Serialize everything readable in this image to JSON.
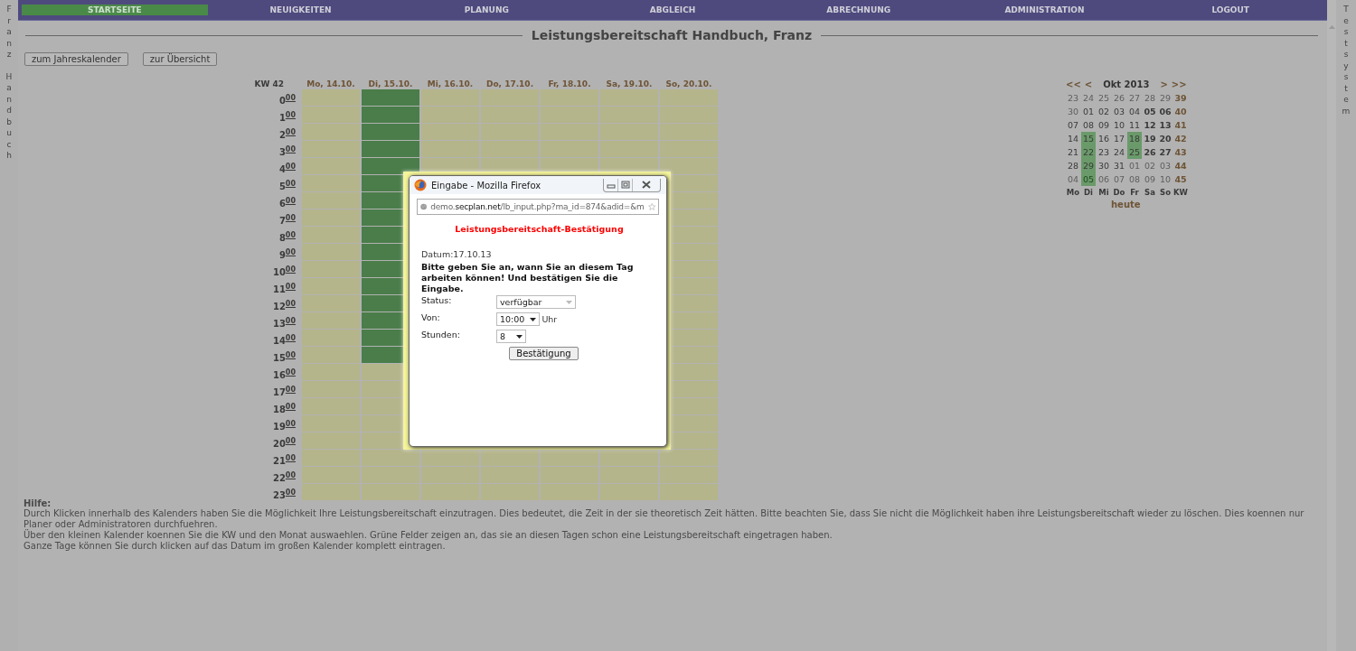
{
  "side_left": "FranzHandbuch",
  "side_right": "Testsystem",
  "nav": [
    {
      "label": "STARTSEITE",
      "selected": true
    },
    {
      "label": "NEUIGKEITEN",
      "selected": false
    },
    {
      "label": "PLANUNG",
      "selected": false
    },
    {
      "label": "ABGLEICH",
      "selected": false
    },
    {
      "label": "ABRECHNUNG",
      "selected": false
    },
    {
      "label": "ADMINISTRATION",
      "selected": false
    },
    {
      "label": "LOGOUT",
      "selected": false
    }
  ],
  "title": "Leistungsbereitschaft Handbuch, Franz",
  "buttons": [
    "zum Jahreskalender",
    "zur Übersicht"
  ],
  "week": {
    "label": "KW 42",
    "days": [
      {
        "label": "Mo, 14.10.",
        "cells_above": [
          false,
          false,
          false,
          false,
          false,
          false,
          false,
          false,
          false,
          false,
          false,
          false,
          false,
          false,
          false,
          false,
          false,
          false,
          false,
          false,
          false,
          false,
          false,
          false
        ]
      },
      {
        "label": "Di, 15.10.",
        "cells_above": [
          true,
          true,
          true,
          true,
          true,
          true,
          true,
          true,
          true,
          true,
          true,
          true,
          true,
          true,
          true,
          true,
          false,
          false,
          false,
          false,
          false,
          false,
          false,
          false
        ]
      },
      {
        "label": "Mi, 16.10.",
        "cells_above": [
          false,
          false,
          false,
          false,
          false
        ],
        "cells_below": [
          false,
          false,
          false
        ]
      },
      {
        "label": "Do, 17.10.",
        "cells_above": [
          false,
          false,
          false,
          false,
          false
        ],
        "cells_below": [
          false,
          false,
          false
        ]
      },
      {
        "label": "Fr, 18.10.",
        "cells_above": [
          false,
          false,
          false,
          false,
          false
        ],
        "cells_below": [
          false,
          false,
          false
        ]
      },
      {
        "label": "Sa, 19.10.",
        "cells_above": [
          false,
          false,
          false,
          false,
          false
        ],
        "cells_below": [
          false,
          false,
          false
        ]
      },
      {
        "label": "So, 20.10.",
        "cells_above": [
          false,
          false,
          false,
          false,
          false,
          false,
          false,
          false,
          false,
          false,
          false,
          false,
          false,
          false,
          false,
          false,
          false,
          false,
          false,
          false,
          false,
          false,
          false,
          false
        ]
      }
    ],
    "hours": [
      "0$^{00}$",
      "1$^{00}$",
      "2$^{00}$",
      "3$^{00}$",
      "4$^{00}$",
      "5$^{00}$",
      "6$^{00}$",
      "7$^{00}$",
      "8$^{00}$",
      "9$^{00}$",
      "10$^{00}$",
      "11$^{00}$",
      "12$^{00}$",
      "13$^{00}$",
      "14$^{00}$",
      "15$^{00}$",
      "16$^{00}$",
      "17$^{00}$",
      "18$^{00}$",
      "19$^{00}$",
      "20$^{00}$",
      "21$^{00}$",
      "22$^{00}$",
      "23$^{00}$"
    ]
  },
  "mini_calendar": {
    "nav": [
      "<<",
      "<",
      ">",
      ">>"
    ],
    "month": "Okt 2013",
    "weeks": [
      {
        "kw": "39",
        "days": [
          {
            "d": "23",
            "kind": "other",
            "marked": false
          },
          {
            "d": "24",
            "kind": "other",
            "marked": false
          },
          {
            "d": "25",
            "kind": "other",
            "marked": false
          },
          {
            "d": "26",
            "kind": "other",
            "marked": false
          },
          {
            "d": "27",
            "kind": "other",
            "marked": false
          },
          {
            "d": "28",
            "kind": "other",
            "marked": false
          },
          {
            "d": "29",
            "kind": "other",
            "marked": false
          }
        ]
      },
      {
        "kw": "40",
        "days": [
          {
            "d": "30",
            "kind": "other",
            "marked": false
          },
          {
            "d": "01",
            "kind": "day",
            "marked": false
          },
          {
            "d": "02",
            "kind": "day",
            "marked": false
          },
          {
            "d": "03",
            "kind": "day",
            "marked": false
          },
          {
            "d": "04",
            "kind": "day",
            "marked": false
          },
          {
            "d": "05",
            "kind": "weekend",
            "marked": false
          },
          {
            "d": "06",
            "kind": "weekend",
            "marked": false
          }
        ]
      },
      {
        "kw": "41",
        "days": [
          {
            "d": "07",
            "kind": "day",
            "marked": false
          },
          {
            "d": "08",
            "kind": "day",
            "marked": false
          },
          {
            "d": "09",
            "kind": "day",
            "marked": false
          },
          {
            "d": "10",
            "kind": "day",
            "marked": false
          },
          {
            "d": "11",
            "kind": "day",
            "marked": false
          },
          {
            "d": "12",
            "kind": "weekend",
            "marked": false
          },
          {
            "d": "13",
            "kind": "weekend",
            "marked": false
          }
        ]
      },
      {
        "kw": "42",
        "days": [
          {
            "d": "14",
            "kind": "day",
            "marked": false
          },
          {
            "d": "15",
            "kind": "day",
            "marked": true
          },
          {
            "d": "16",
            "kind": "day",
            "marked": false
          },
          {
            "d": "17",
            "kind": "day",
            "marked": false
          },
          {
            "d": "18",
            "kind": "day",
            "marked": true
          },
          {
            "d": "19",
            "kind": "weekend",
            "marked": false
          },
          {
            "d": "20",
            "kind": "weekend",
            "marked": false
          }
        ]
      },
      {
        "kw": "43",
        "days": [
          {
            "d": "21",
            "kind": "day",
            "marked": false
          },
          {
            "d": "22",
            "kind": "day",
            "marked": true
          },
          {
            "d": "23",
            "kind": "day",
            "marked": false
          },
          {
            "d": "24",
            "kind": "day",
            "marked": false
          },
          {
            "d": "25",
            "kind": "day",
            "marked": true
          },
          {
            "d": "26",
            "kind": "weekend",
            "marked": false
          },
          {
            "d": "27",
            "kind": "weekend",
            "marked": false
          }
        ]
      },
      {
        "kw": "44",
        "days": [
          {
            "d": "28",
            "kind": "day",
            "marked": false
          },
          {
            "d": "29",
            "kind": "day",
            "marked": true
          },
          {
            "d": "30",
            "kind": "day",
            "marked": false
          },
          {
            "d": "31",
            "kind": "day",
            "marked": false
          },
          {
            "d": "01",
            "kind": "other",
            "marked": false
          },
          {
            "d": "02",
            "kind": "other",
            "marked": false
          },
          {
            "d": "03",
            "kind": "other",
            "marked": false
          }
        ]
      },
      {
        "kw": "45",
        "days": [
          {
            "d": "04",
            "kind": "other",
            "marked": false
          },
          {
            "d": "05",
            "kind": "other",
            "marked": true
          },
          {
            "d": "06",
            "kind": "other",
            "marked": false
          },
          {
            "d": "07",
            "kind": "other",
            "marked": false
          },
          {
            "d": "08",
            "kind": "other",
            "marked": false
          },
          {
            "d": "09",
            "kind": "other",
            "marked": false
          },
          {
            "d": "10",
            "kind": "other",
            "marked": false
          }
        ]
      }
    ],
    "weekdays": [
      "Mo",
      "Di",
      "Mi",
      "Do",
      "Fr",
      "Sa",
      "So",
      "KW"
    ],
    "today": "heute"
  },
  "help": {
    "heading": "Hilfe:",
    "lines": [
      "Durch Klicken innerhalb des Kalenders haben Sie die Möglichkeit Ihre Leistungsbereitschaft einzutragen. Dies bedeutet, die Zeit in der sie theoretisch Zeit hätten. Bitte beachten Sie, dass Sie nicht die Möglichkeit haben ihre Leistungsbereitschaft wieder zu löschen. Dies koennen nur Planer oder Administratoren durchfuehren.",
      "Über den kleinen Kalender koennen Sie die KW und den Monat auswaehlen. Grüne Felder zeigen an, das sie an diesen Tagen schon eine Leistungsbereitschaft eingetragen haben.",
      "Ganze Tage können Sie durch klicken auf das Datum im großen Kalender komplett eintragen."
    ]
  },
  "popup": {
    "window_title": "Eingabe - Mozilla Firefox",
    "url": "demo.**secplan.net**/lb_input.php?ma_id=874&adid=&m",
    "heading": "Leistungsbereitschaft-Bestätigung",
    "date": "Datum:17.10.13",
    "instruction": "Bitte geben Sie an, wann Sie an diesem Tag arbeiten können! Und bestätigen Sie die Eingabe.",
    "status_label": "Status:",
    "status_value": "verfügbar",
    "from_label": "Von:",
    "from_value": "10:00",
    "from_unit": "Uhr",
    "hours_label": "Stunden:",
    "hours_value": "8",
    "confirm": "Bestätigung"
  }
}
